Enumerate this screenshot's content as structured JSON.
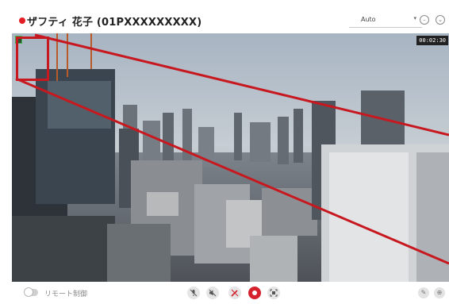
{
  "header": {
    "title": "ザフティ 花子 (01PXXXXXXXXX)",
    "quality": {
      "value": "Auto",
      "caret": "▾"
    },
    "icons": [
      "circle-minus-icon",
      "circle-chevron-icon"
    ],
    "icon_glyphs": [
      "–",
      "⌄"
    ]
  },
  "video": {
    "timecode": "00:02:30",
    "annotation_color": "#c8181f"
  },
  "footer": {
    "remote_control_label": "リモート制御",
    "controls": [
      {
        "name": "mic-mute-icon",
        "glyph": "🎙̸"
      },
      {
        "name": "speaker-mute-icon",
        "glyph": "✕"
      },
      {
        "name": "draw-icon",
        "glyph": "✎"
      },
      {
        "name": "record-icon",
        "glyph": ""
      },
      {
        "name": "capture-icon",
        "glyph": "◘"
      }
    ],
    "right_icons": [
      {
        "name": "edit-icon",
        "glyph": "✎"
      },
      {
        "name": "crosshair-icon",
        "glyph": "⊕"
      }
    ]
  },
  "colors": {
    "record_red": "#e31e24",
    "control_red": "#d4212b"
  }
}
